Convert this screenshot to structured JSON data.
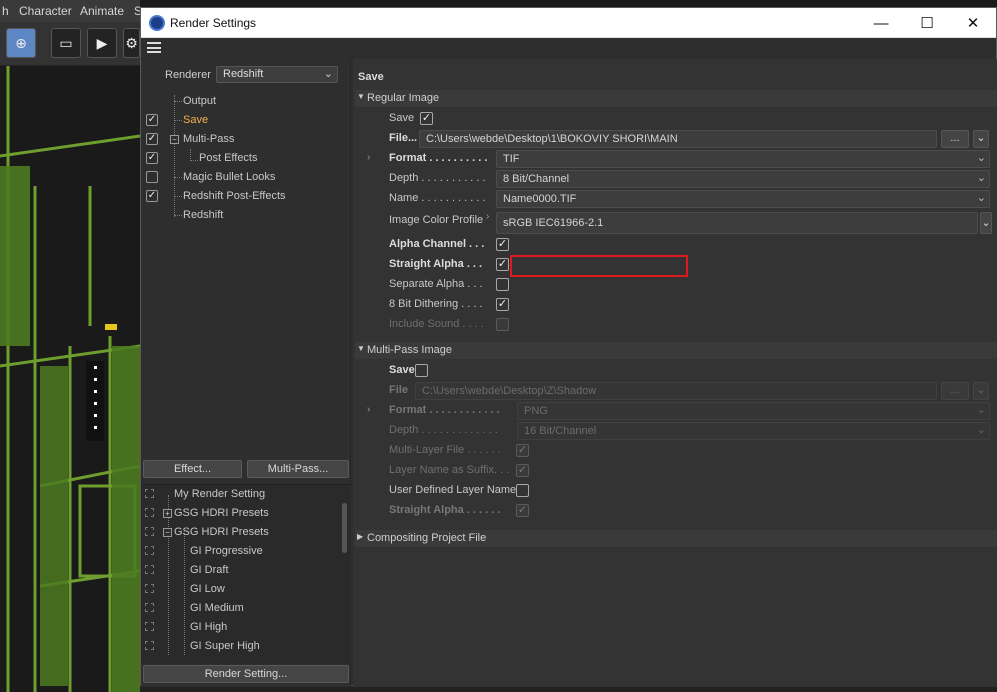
{
  "background_app": {
    "menu": [
      "h",
      "Character",
      "Animate",
      "S"
    ]
  },
  "window": {
    "title": "Render Settings",
    "controls": {
      "minimize": "—",
      "maximize": "☐",
      "close": "✕"
    }
  },
  "left_panel": {
    "renderer_label": "Renderer",
    "renderer_value": "Redshift",
    "tree": [
      {
        "label": "Output",
        "checked": null
      },
      {
        "label": "Save",
        "checked": true,
        "active": true
      },
      {
        "label": "Multi-Pass",
        "checked": true
      },
      {
        "label": "Post Effects",
        "checked": true
      },
      {
        "label": "Magic Bullet Looks",
        "checked": false
      },
      {
        "label": "Redshift Post-Effects",
        "checked": true
      },
      {
        "label": "Redshift",
        "checked": null
      }
    ],
    "effect_button": "Effect...",
    "multipass_button": "Multi-Pass...",
    "presets": [
      "My Render Setting",
      "GSG HDRI Presets",
      "GSG HDRI Presets",
      "GI Progressive",
      "GI Draft",
      "GI Low",
      "GI Medium",
      "GI High",
      "GI Super High"
    ],
    "render_setting_button": "Render Setting..."
  },
  "right_panel": {
    "heading": "Save",
    "regular_image": {
      "section_label": "Regular Image",
      "save_label": "Save",
      "save_checked": true,
      "file_label": "File...",
      "file_value": "C:\\Users\\webde\\Desktop\\1\\BOKOVIY SHORI\\MAIN",
      "browse": "...",
      "format_label": "Format . . . . . . . . . .",
      "format_value": "TIF",
      "depth_label": "Depth . . . . . . . . . . .",
      "depth_value": "8 Bit/Channel",
      "name_label": "Name . . . . . . . . . . .",
      "name_value": "Name0000.TIF",
      "profile_label": "Image Color Profile",
      "profile_value": "sRGB IEC61966-2.1",
      "alpha_label": "Alpha Channel . . .",
      "alpha_checked": true,
      "straight_alpha_label": "Straight Alpha . . .",
      "straight_alpha_checked": true,
      "separate_alpha_label": "Separate Alpha . . .",
      "separate_alpha_checked": false,
      "dithering_label": "8 Bit Dithering . . . .",
      "dithering_checked": true,
      "include_sound_label": "Include Sound . . . .",
      "include_sound_checked": false
    },
    "multipass_image": {
      "section_label": "Multi-Pass Image",
      "save_label": "Save",
      "save_checked": false,
      "file_label": "File",
      "file_value": "C:\\Users\\webde\\Desktop\\Z\\Shadow",
      "browse": "...",
      "format_label": "Format . . . . . . . . . . . .",
      "format_value": "PNG",
      "depth_label": "Depth . . . . . . . . . . . . .",
      "depth_value": "16 Bit/Channel",
      "multilayer_label": "Multi-Layer File . . . . . .",
      "multilayer_checked": true,
      "layer_suffix_label": "Layer Name as Suffix. . .",
      "layer_suffix_checked": true,
      "user_defined_label": "User Defined Layer Name",
      "user_defined_checked": false,
      "straight_alpha_label": "Straight Alpha . . . . . .",
      "straight_alpha_checked": true
    },
    "compositing_label": "Compositing Project File"
  },
  "colors": {
    "active_item": "#f1b24a",
    "highlight_box": "#e0191e",
    "viewport_green": "#3c5a1e"
  }
}
